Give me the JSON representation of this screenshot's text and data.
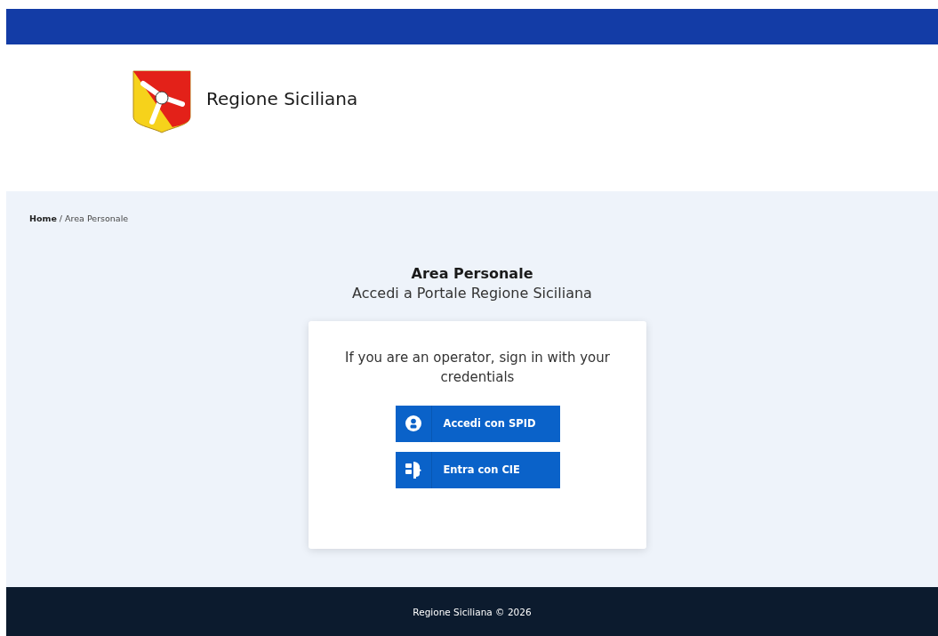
{
  "header": {
    "title": "Regione Siciliana"
  },
  "breadcrumb": {
    "items": [
      "Home",
      "Area Personale"
    ],
    "separator": "/"
  },
  "login": {
    "title": "Area Personale",
    "subtitle": "Accedi a Portale Regione Siciliana",
    "message": "If you are an operator, sign in with your credentials",
    "buttons": [
      {
        "kind": "spid",
        "label": "Accedi con SPID"
      },
      {
        "kind": "cie",
        "label": "Entra con CIE"
      }
    ]
  },
  "footer": {
    "text": "Regione Siciliana © 2026"
  }
}
